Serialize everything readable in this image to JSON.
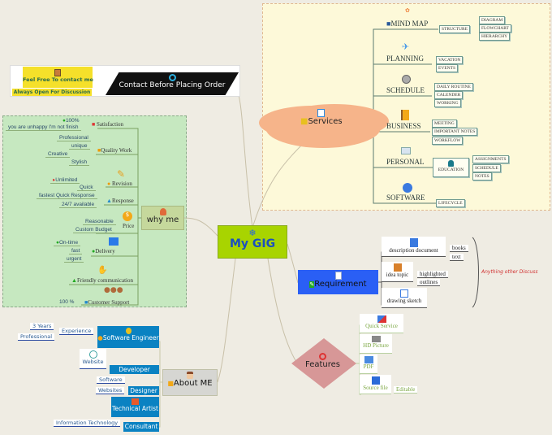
{
  "center": {
    "label": "My GIG",
    "icon": "snowflake-icon"
  },
  "contact": {
    "title": "Contact Before Placing Order",
    "line1": "Feel Free To contact me",
    "line2": "Always Open For Discussion",
    "icon": "stopwatch-icon"
  },
  "why_me": {
    "label": "why me",
    "items": [
      {
        "label": "Satisfaction",
        "subs": [
          "100%",
          "you are unhappy I'm not finish"
        ]
      },
      {
        "label": "Quality Work",
        "subs": [
          "Professional",
          "unique",
          "Creative",
          "Stylish"
        ]
      },
      {
        "label": "Revision",
        "subs": [
          "Unlimited",
          "Quick"
        ]
      },
      {
        "label": "Response",
        "subs": [
          "fastest Quick Response",
          "24/7 available"
        ]
      },
      {
        "label": "Price",
        "subs": [
          "Reasonable",
          "Custom Budget"
        ]
      },
      {
        "label": "Delivery",
        "subs": [
          "On-time",
          "fast",
          "urgent"
        ]
      },
      {
        "label": "Friendly communication",
        "subs": []
      },
      {
        "label": "Customer Support",
        "subs": [
          "100 %"
        ]
      }
    ]
  },
  "services": {
    "label": "Services",
    "items": [
      {
        "label": "MIND MAP",
        "mid": "STRUCTURE",
        "subs": [
          "DIAGRAM",
          "FLOWCHART",
          "HIERARCHY"
        ]
      },
      {
        "label": "PLANNING",
        "subs": [
          "VACATION",
          "EVENTS"
        ]
      },
      {
        "label": "SCHEDULE",
        "subs": [
          "DAILY ROUTINE",
          "CALENDER",
          "WORKING"
        ]
      },
      {
        "label": "BUSINESS",
        "subs": [
          "MEETING",
          "IMPORTANT NOTES",
          "WORKFLOW"
        ]
      },
      {
        "label": "PERSONAL",
        "mid": "EDUCATION",
        "subs": [
          "ASSIGNMENTS",
          "SCHEDULE",
          "NOTES"
        ]
      },
      {
        "label": "SOFTWARE",
        "subs": [
          "LIFECYCLE"
        ]
      }
    ]
  },
  "requirement": {
    "label": "Requirement",
    "items": [
      {
        "label": "description document",
        "subs": [
          "books",
          "text"
        ]
      },
      {
        "label": "idea topic",
        "subs": [
          "highlighted",
          "outlines"
        ]
      },
      {
        "label": "drawing sketch"
      }
    ],
    "note": "Anything other Discuss",
    "note_color": "#d03030"
  },
  "features": {
    "label": "Features",
    "items": [
      "Quick Service",
      "HD Picture",
      "PDF",
      "Source file"
    ],
    "source_sub": "Editable"
  },
  "about": {
    "label": "About ME",
    "items": [
      {
        "label": "Software Engineer",
        "sub": "Experience",
        "subsubs": [
          "3 Years",
          "Professional"
        ]
      },
      {
        "label": "Developer",
        "sub": "Website"
      },
      {
        "label": "Designer",
        "subs": [
          "Software",
          "Websites"
        ]
      },
      {
        "label": "Technical Artist"
      },
      {
        "label": "Consultant",
        "sub": "Information Technology"
      }
    ]
  },
  "colors": {
    "center": "#a8d400",
    "services_cloud": "#f6b48a",
    "requirement": "#2a5ff5",
    "features": "#d79797",
    "about_blue": "#0a82c2",
    "why_panel": "#c6e8c0"
  }
}
